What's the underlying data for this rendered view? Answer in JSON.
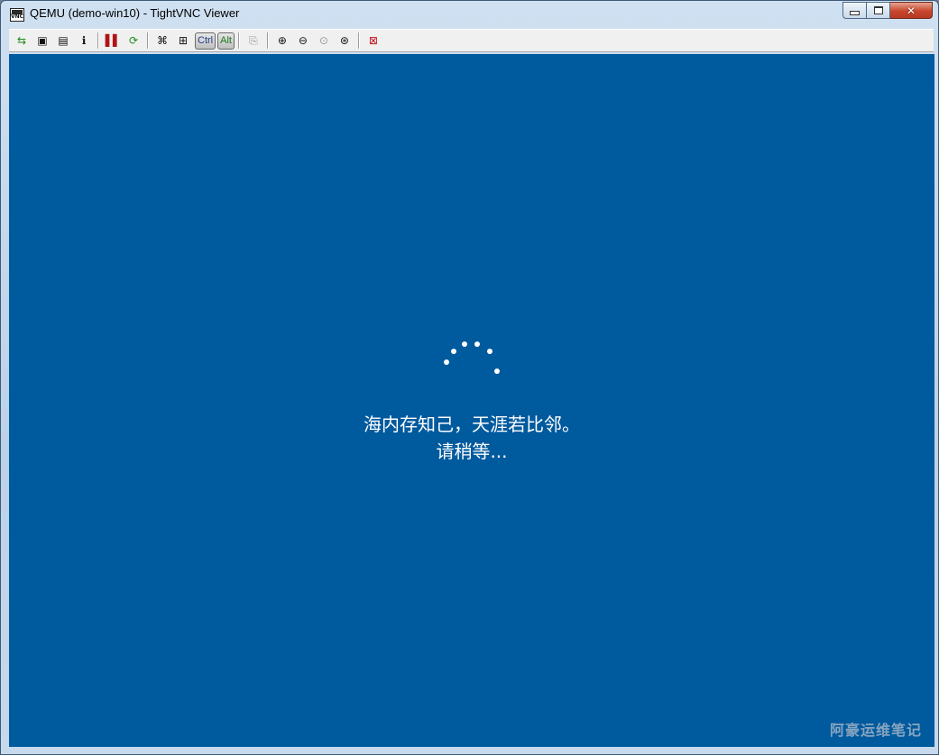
{
  "window": {
    "title": "QEMU (demo-win10) - TightVNC Viewer",
    "icon": "vnc-app-icon",
    "controls": [
      "minimize-icon",
      "restore-icon",
      "close-icon"
    ]
  },
  "toolbar": {
    "buttons": [
      "new-connection-icon",
      "save-icon",
      "connection-options-icon",
      "connection-info-icon",
      "pause-icon",
      "refresh-icon",
      "send-ctrl-alt-del-icon",
      "send-ctrl-esc-icon",
      "copy-clipboard-icon",
      "zoom-in-icon",
      "zoom-out-icon",
      "zoom-100-icon",
      "zoom-auto-icon",
      "full-screen-icon"
    ],
    "ctrl_label": "Ctrl",
    "alt_label": "Alt"
  },
  "desktop": {
    "background": "#005a9e",
    "message_line1": "海内存知己，天涯若比邻。",
    "message_line2": "请稍等...",
    "watermark": "阿豪运维笔记"
  }
}
